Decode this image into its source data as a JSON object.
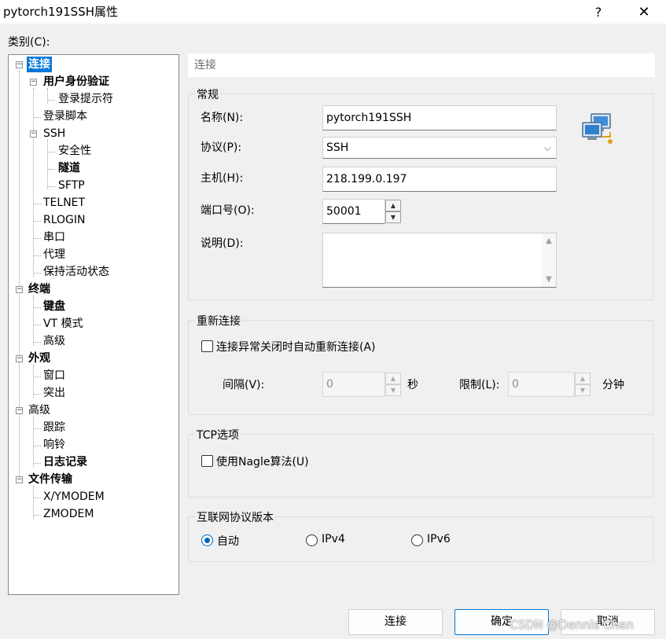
{
  "window": {
    "title": "pytorch191SSH属性",
    "help": "?",
    "close": "✕"
  },
  "category_label": "类别(C):",
  "tree": [
    {
      "label": "连接",
      "bold": true,
      "selected": true,
      "expander": "−"
    },
    {
      "label": "用户身份验证",
      "bold": true,
      "expander": "−"
    },
    {
      "label": "登录提示符"
    },
    {
      "label": "登录脚本"
    },
    {
      "label": "SSH",
      "expander": "−"
    },
    {
      "label": "安全性"
    },
    {
      "label": "隧道",
      "bold": true
    },
    {
      "label": "SFTP"
    },
    {
      "label": "TELNET"
    },
    {
      "label": "RLOGIN"
    },
    {
      "label": "串口"
    },
    {
      "label": "代理"
    },
    {
      "label": "保持活动状态"
    },
    {
      "label": "终端",
      "bold": true,
      "expander": "−"
    },
    {
      "label": "键盘",
      "bold": true
    },
    {
      "label": "VT 模式"
    },
    {
      "label": "高级"
    },
    {
      "label": "外观",
      "bold": true,
      "expander": "−"
    },
    {
      "label": "窗口"
    },
    {
      "label": "突出"
    },
    {
      "label": "高级",
      "expander": "−"
    },
    {
      "label": "跟踪"
    },
    {
      "label": "响铃"
    },
    {
      "label": "日志记录",
      "bold": true
    },
    {
      "label": "文件传输",
      "bold": true,
      "expander": "−"
    },
    {
      "label": "X/YMODEM"
    },
    {
      "label": "ZMODEM"
    }
  ],
  "section_header": "连接",
  "general": {
    "title": "常规",
    "name_label": "名称(N):",
    "name_value": "pytorch191SSH",
    "protocol_label": "协议(P):",
    "protocol_value": "SSH",
    "host_label": "主机(H):",
    "host_value": "218.199.0.197",
    "port_label": "端口号(O):",
    "port_value": "50001",
    "desc_label": "说明(D):",
    "desc_value": ""
  },
  "reconnect": {
    "title": "重新连接",
    "auto_label": "连接异常关闭时自动重新连接(A)",
    "auto_checked": false,
    "interval_label": "间隔(V):",
    "interval_value": "0",
    "interval_unit": "秒",
    "limit_label": "限制(L):",
    "limit_value": "0",
    "limit_unit": "分钟"
  },
  "tcp": {
    "title": "TCP选项",
    "nagle_label": "使用Nagle算法(U)",
    "nagle_checked": false
  },
  "ipver": {
    "title": "互联网协议版本",
    "options": [
      {
        "label": "自动",
        "checked": true
      },
      {
        "label": "IPv4",
        "checked": false
      },
      {
        "label": "IPv6",
        "checked": false
      }
    ]
  },
  "buttons": {
    "connect": "连接",
    "ok": "确定",
    "cancel": "取消"
  },
  "watermark": "CSDN @Dennis Chen",
  "colors": {
    "selection": "#0078d7",
    "radio_accent": "#0067c0"
  }
}
